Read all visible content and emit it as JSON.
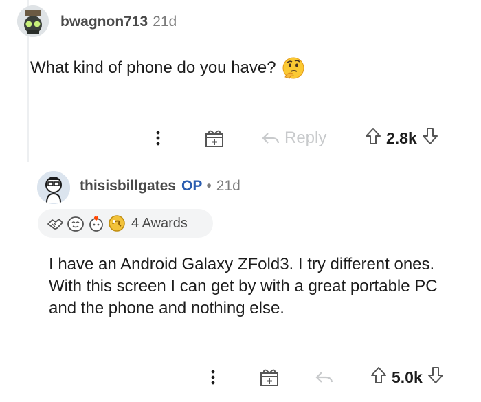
{
  "comments": [
    {
      "username": "bwagnon713",
      "age": "21d",
      "body": "What kind of phone do you have?",
      "emoji": "thinking-face",
      "actions": {
        "reply_label": "Reply",
        "score": "2.8k"
      }
    },
    {
      "username": "thisisbillgates",
      "op_badge": "OP",
      "separator": "•",
      "age": "21d",
      "awards_label": "4 Awards",
      "body": "I have an Android Galaxy ZFold3. I try different ones. With this screen I can get by with a great portable PC and the phone and nothing else.",
      "actions": {
        "score": "5.0k"
      }
    }
  ],
  "colors": {
    "op": "#2a5db0",
    "muted": "#878a8c",
    "pill": "#f3f4f5"
  }
}
